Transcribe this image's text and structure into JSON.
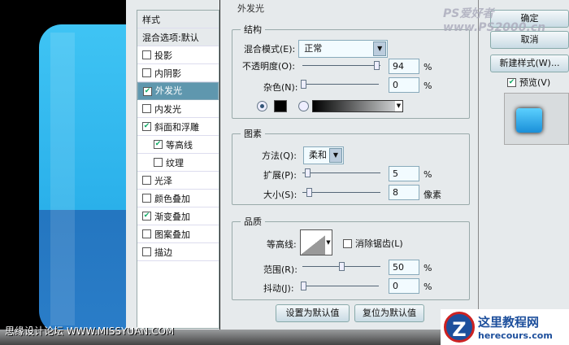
{
  "dialog": {
    "title": "外发光"
  },
  "styles_list": [
    {
      "label": "样式",
      "type": "header"
    },
    {
      "label": "混合选项:默认",
      "type": "header"
    },
    {
      "label": "投影",
      "checked": false
    },
    {
      "label": "内阴影",
      "checked": false
    },
    {
      "label": "外发光",
      "checked": true,
      "selected": true
    },
    {
      "label": "内发光",
      "checked": false
    },
    {
      "label": "斜面和浮雕",
      "checked": true
    },
    {
      "label": "等高线",
      "checked": true,
      "sub": true
    },
    {
      "label": "纹理",
      "checked": false,
      "sub": true
    },
    {
      "label": "光泽",
      "checked": false
    },
    {
      "label": "颜色叠加",
      "checked": false
    },
    {
      "label": "渐变叠加",
      "checked": true
    },
    {
      "label": "图案叠加",
      "checked": false
    },
    {
      "label": "描边",
      "checked": false
    }
  ],
  "structure": {
    "legend": "结构",
    "blend_label": "混合模式(E):",
    "blend_value": "正常",
    "opacity_label": "不透明度(O):",
    "opacity_value": "94",
    "opacity_unit": "%",
    "noise_label": "杂色(N):",
    "noise_value": "0",
    "noise_unit": "%"
  },
  "elements": {
    "legend": "图素",
    "method_label": "方法(Q):",
    "method_value": "柔和",
    "spread_label": "扩展(P):",
    "spread_value": "5",
    "spread_unit": "%",
    "size_label": "大小(S):",
    "size_value": "8",
    "size_unit": "像素"
  },
  "quality": {
    "legend": "品质",
    "contour_label": "等高线:",
    "antialias_label": "消除锯齿(L)",
    "range_label": "范围(R):",
    "range_value": "50",
    "range_unit": "%",
    "jitter_label": "抖动(J):",
    "jitter_value": "0",
    "jitter_unit": "%"
  },
  "buttons": {
    "ok": "确定",
    "cancel": "取消",
    "new_style": "新建样式(W)...",
    "preview": "预览(V)",
    "make_default": "设置为默认值",
    "reset_default": "复位为默认值"
  },
  "watermarks": {
    "top": "PS爱好者 www.PS2000.cn",
    "bottom_left": "思缘设计论坛 WWW.MISSYUAN.COM",
    "bottom_right_title": "这里教程网",
    "bottom_right_url": "herecours.com"
  }
}
